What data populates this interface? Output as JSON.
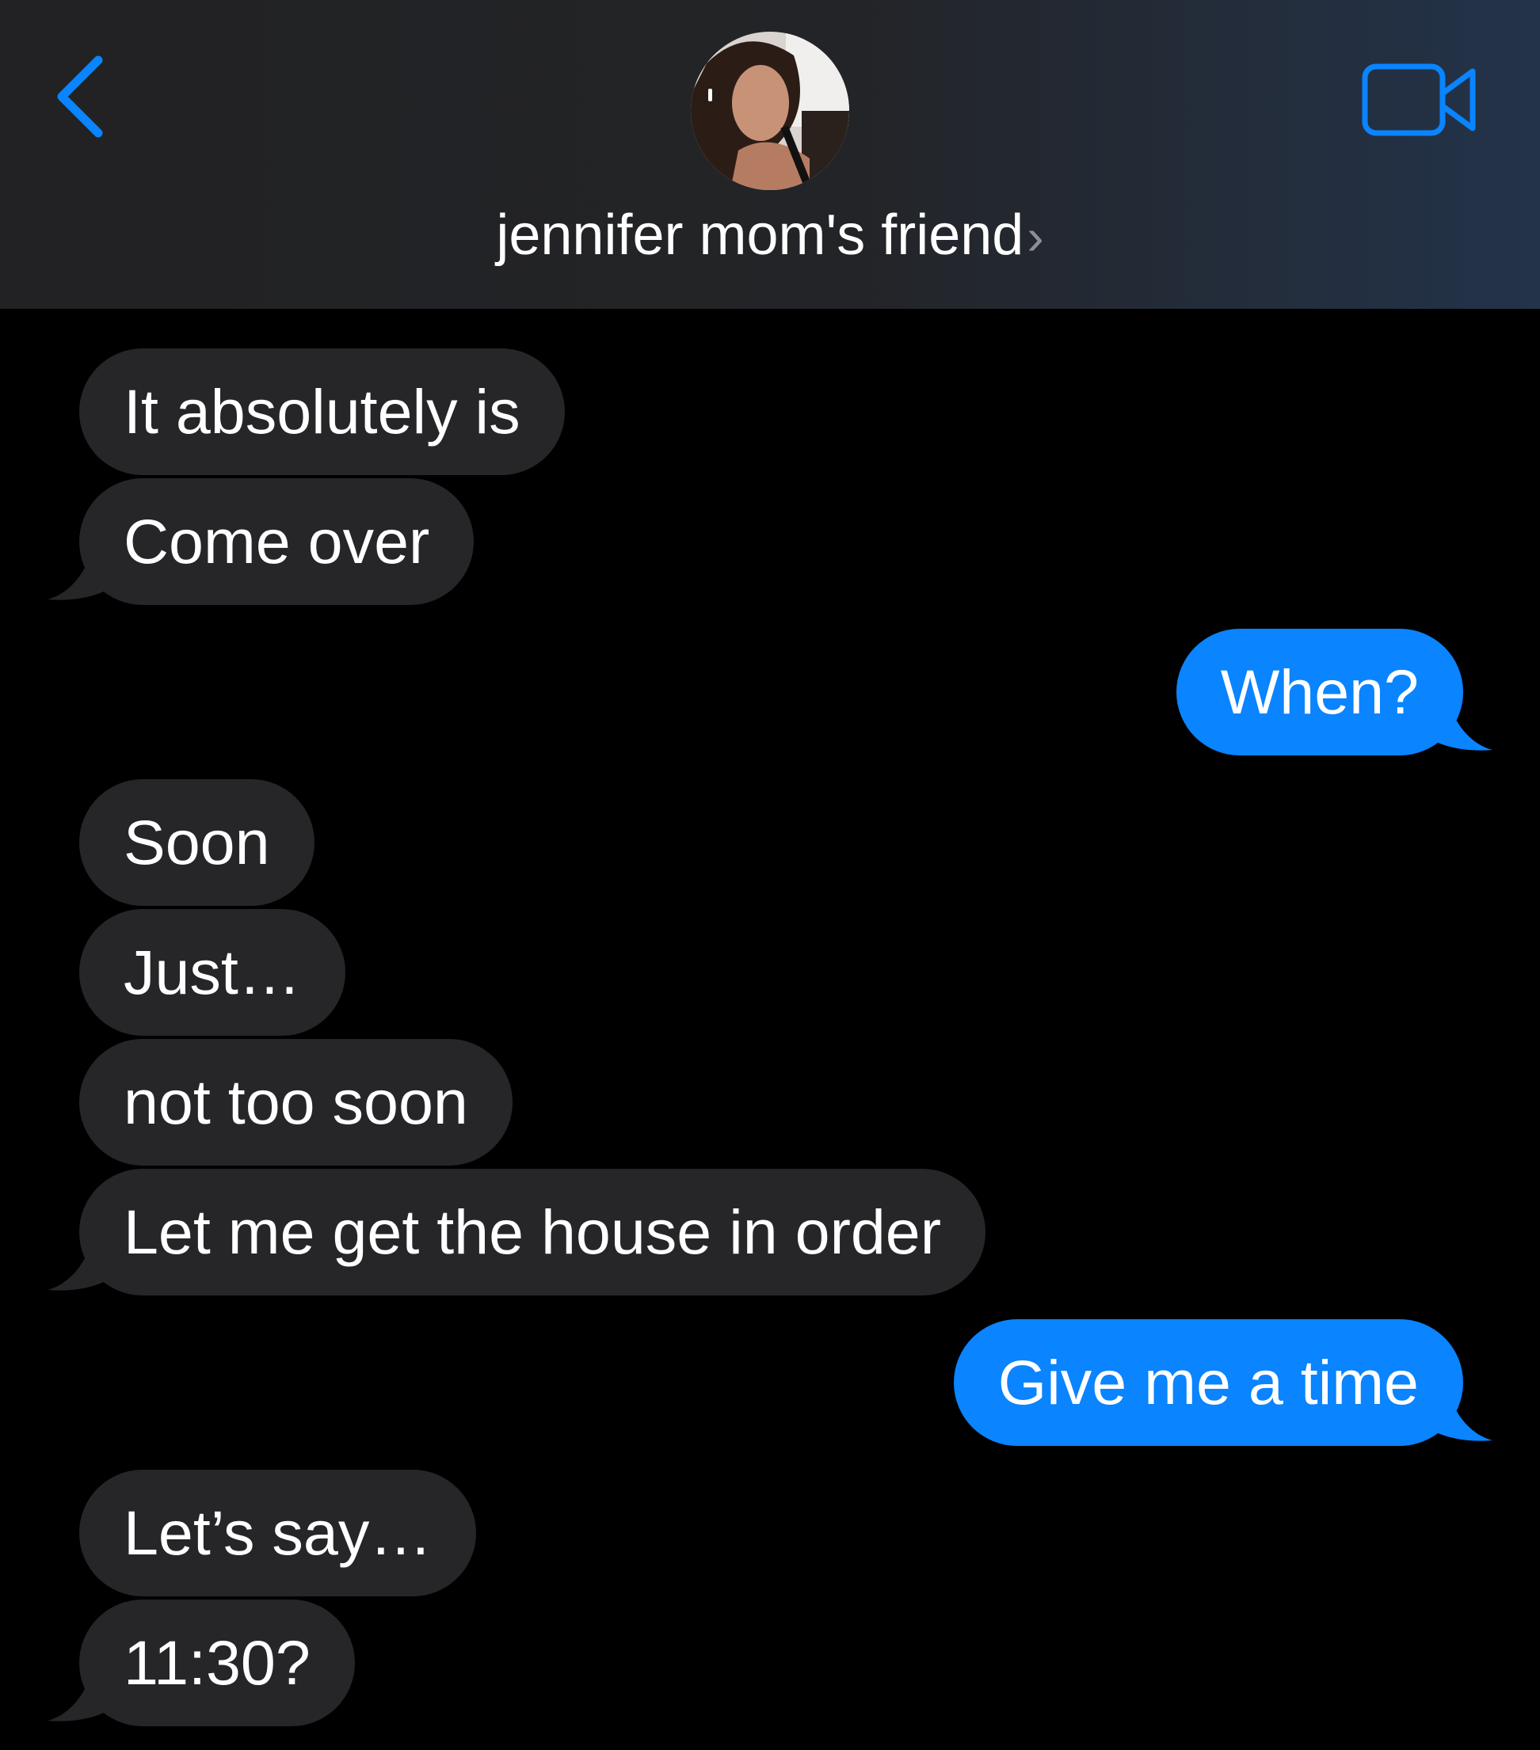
{
  "header": {
    "back_icon": "chevron-left-icon",
    "video_icon": "video-camera-icon",
    "contact_name": "jennifer mom's friend",
    "contact_chevron": "›",
    "accent_color": "#0a84ff"
  },
  "messages": [
    {
      "direction": "incoming",
      "text": "It absolutely is"
    },
    {
      "direction": "incoming",
      "text": "Come over"
    },
    {
      "direction": "outgoing",
      "text": "When?"
    },
    {
      "direction": "incoming",
      "text": "Soon"
    },
    {
      "direction": "incoming",
      "text": "Just…"
    },
    {
      "direction": "incoming",
      "text": "not too soon"
    },
    {
      "direction": "incoming",
      "text": "Let me get the house in order"
    },
    {
      "direction": "outgoing",
      "text": "Give me a time"
    },
    {
      "direction": "incoming",
      "text": "Let’s say…"
    },
    {
      "direction": "incoming",
      "text": "11:30?"
    }
  ],
  "colors": {
    "incoming_bubble": "#262629",
    "outgoing_bubble": "#0a84ff",
    "background": "#000000"
  }
}
